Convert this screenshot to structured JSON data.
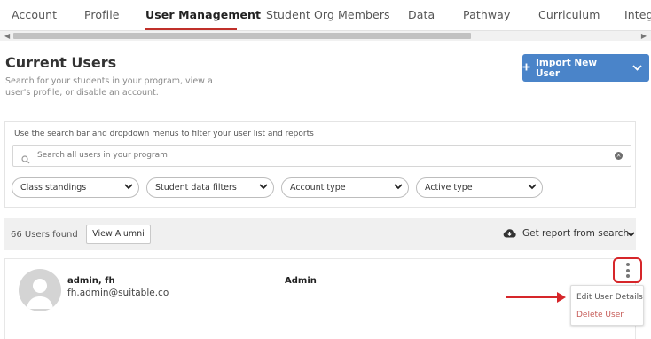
{
  "tabs": [
    {
      "label": "Account",
      "active": false
    },
    {
      "label": "Profile",
      "active": false
    },
    {
      "label": "User Management",
      "active": true
    },
    {
      "label": "Student Org Members",
      "active": false
    },
    {
      "label": "Data",
      "active": false
    },
    {
      "label": "Pathway",
      "active": false
    },
    {
      "label": "Curriculum",
      "active": false
    },
    {
      "label": "Integ",
      "active": false
    }
  ],
  "header": {
    "title": "Current Users",
    "subtitle": "Search for your students in your program, view a user's profile, or disable an account.",
    "import_button": {
      "label": "Import New User",
      "icon": "plus-icon"
    }
  },
  "filters": {
    "hint": "Use the search bar and dropdown menus to filter your user list and reports",
    "search": {
      "placeholder": "Search all users in your program",
      "value": ""
    },
    "dropdowns": [
      {
        "label": "Class standings"
      },
      {
        "label": "Student data filters"
      },
      {
        "label": "Account type"
      },
      {
        "label": "Active type"
      }
    ]
  },
  "results": {
    "count_text": "66 Users found",
    "alumni_button": "View Alumni",
    "report_button": "Get report from search"
  },
  "user": {
    "name": "admin, fh",
    "email": "fh.admin@suitable.co",
    "role": "Admin"
  },
  "menu": {
    "edit": "Edit User Details",
    "delete": "Delete User"
  },
  "colors": {
    "accent": "#4a84c9",
    "active_tab_underline": "#c0302a",
    "annotation_red": "#d6262a",
    "delete_text": "#c65b57"
  }
}
